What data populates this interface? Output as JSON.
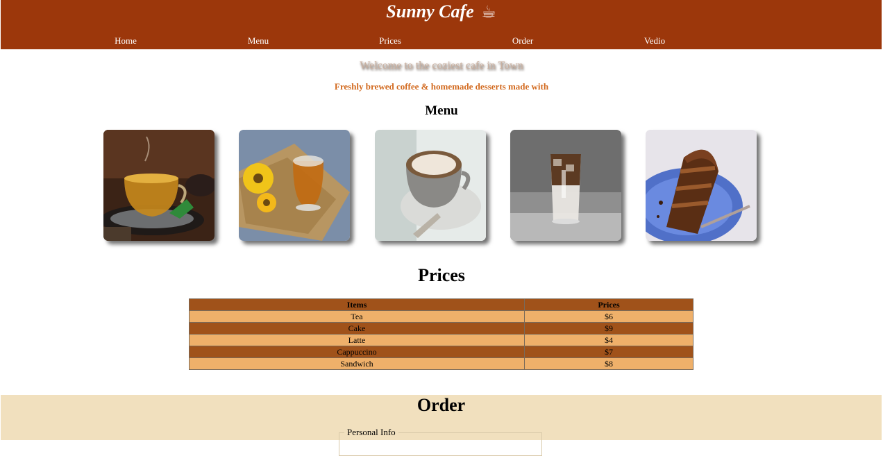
{
  "header": {
    "title": "Sunny Cafe",
    "title_icon": "☕",
    "nav": [
      "Home",
      "Menu",
      "Prices",
      "Order",
      "Vedio"
    ]
  },
  "intro": {
    "welcome": "Welcome to the coziest cafe in Town",
    "tagline": "Freshly brewed coffee & homemade desserts made with"
  },
  "menu": {
    "title": "Menu",
    "items": [
      "herbal-tea-photo",
      "black-tea-photo",
      "cappuccino-photo",
      "iced-latte-photo",
      "chocolate-cake-photo"
    ]
  },
  "prices": {
    "title": "Prices",
    "headers": [
      "Items",
      "Prices"
    ],
    "rows": [
      [
        "Tea",
        "$6"
      ],
      [
        "Cake",
        "$9"
      ],
      [
        "Latte",
        "$4"
      ],
      [
        "Cappuccino",
        "$7"
      ],
      [
        "Sandwich",
        "$8"
      ]
    ]
  },
  "order": {
    "title": "Order",
    "personal_info_legend": "Personal Info"
  },
  "colors": {
    "header_bg": "#9c370b",
    "tagline": "#d2691e",
    "table_header": "#a0521a",
    "table_light": "#efb06a",
    "order_bg": "#f1e0be"
  }
}
